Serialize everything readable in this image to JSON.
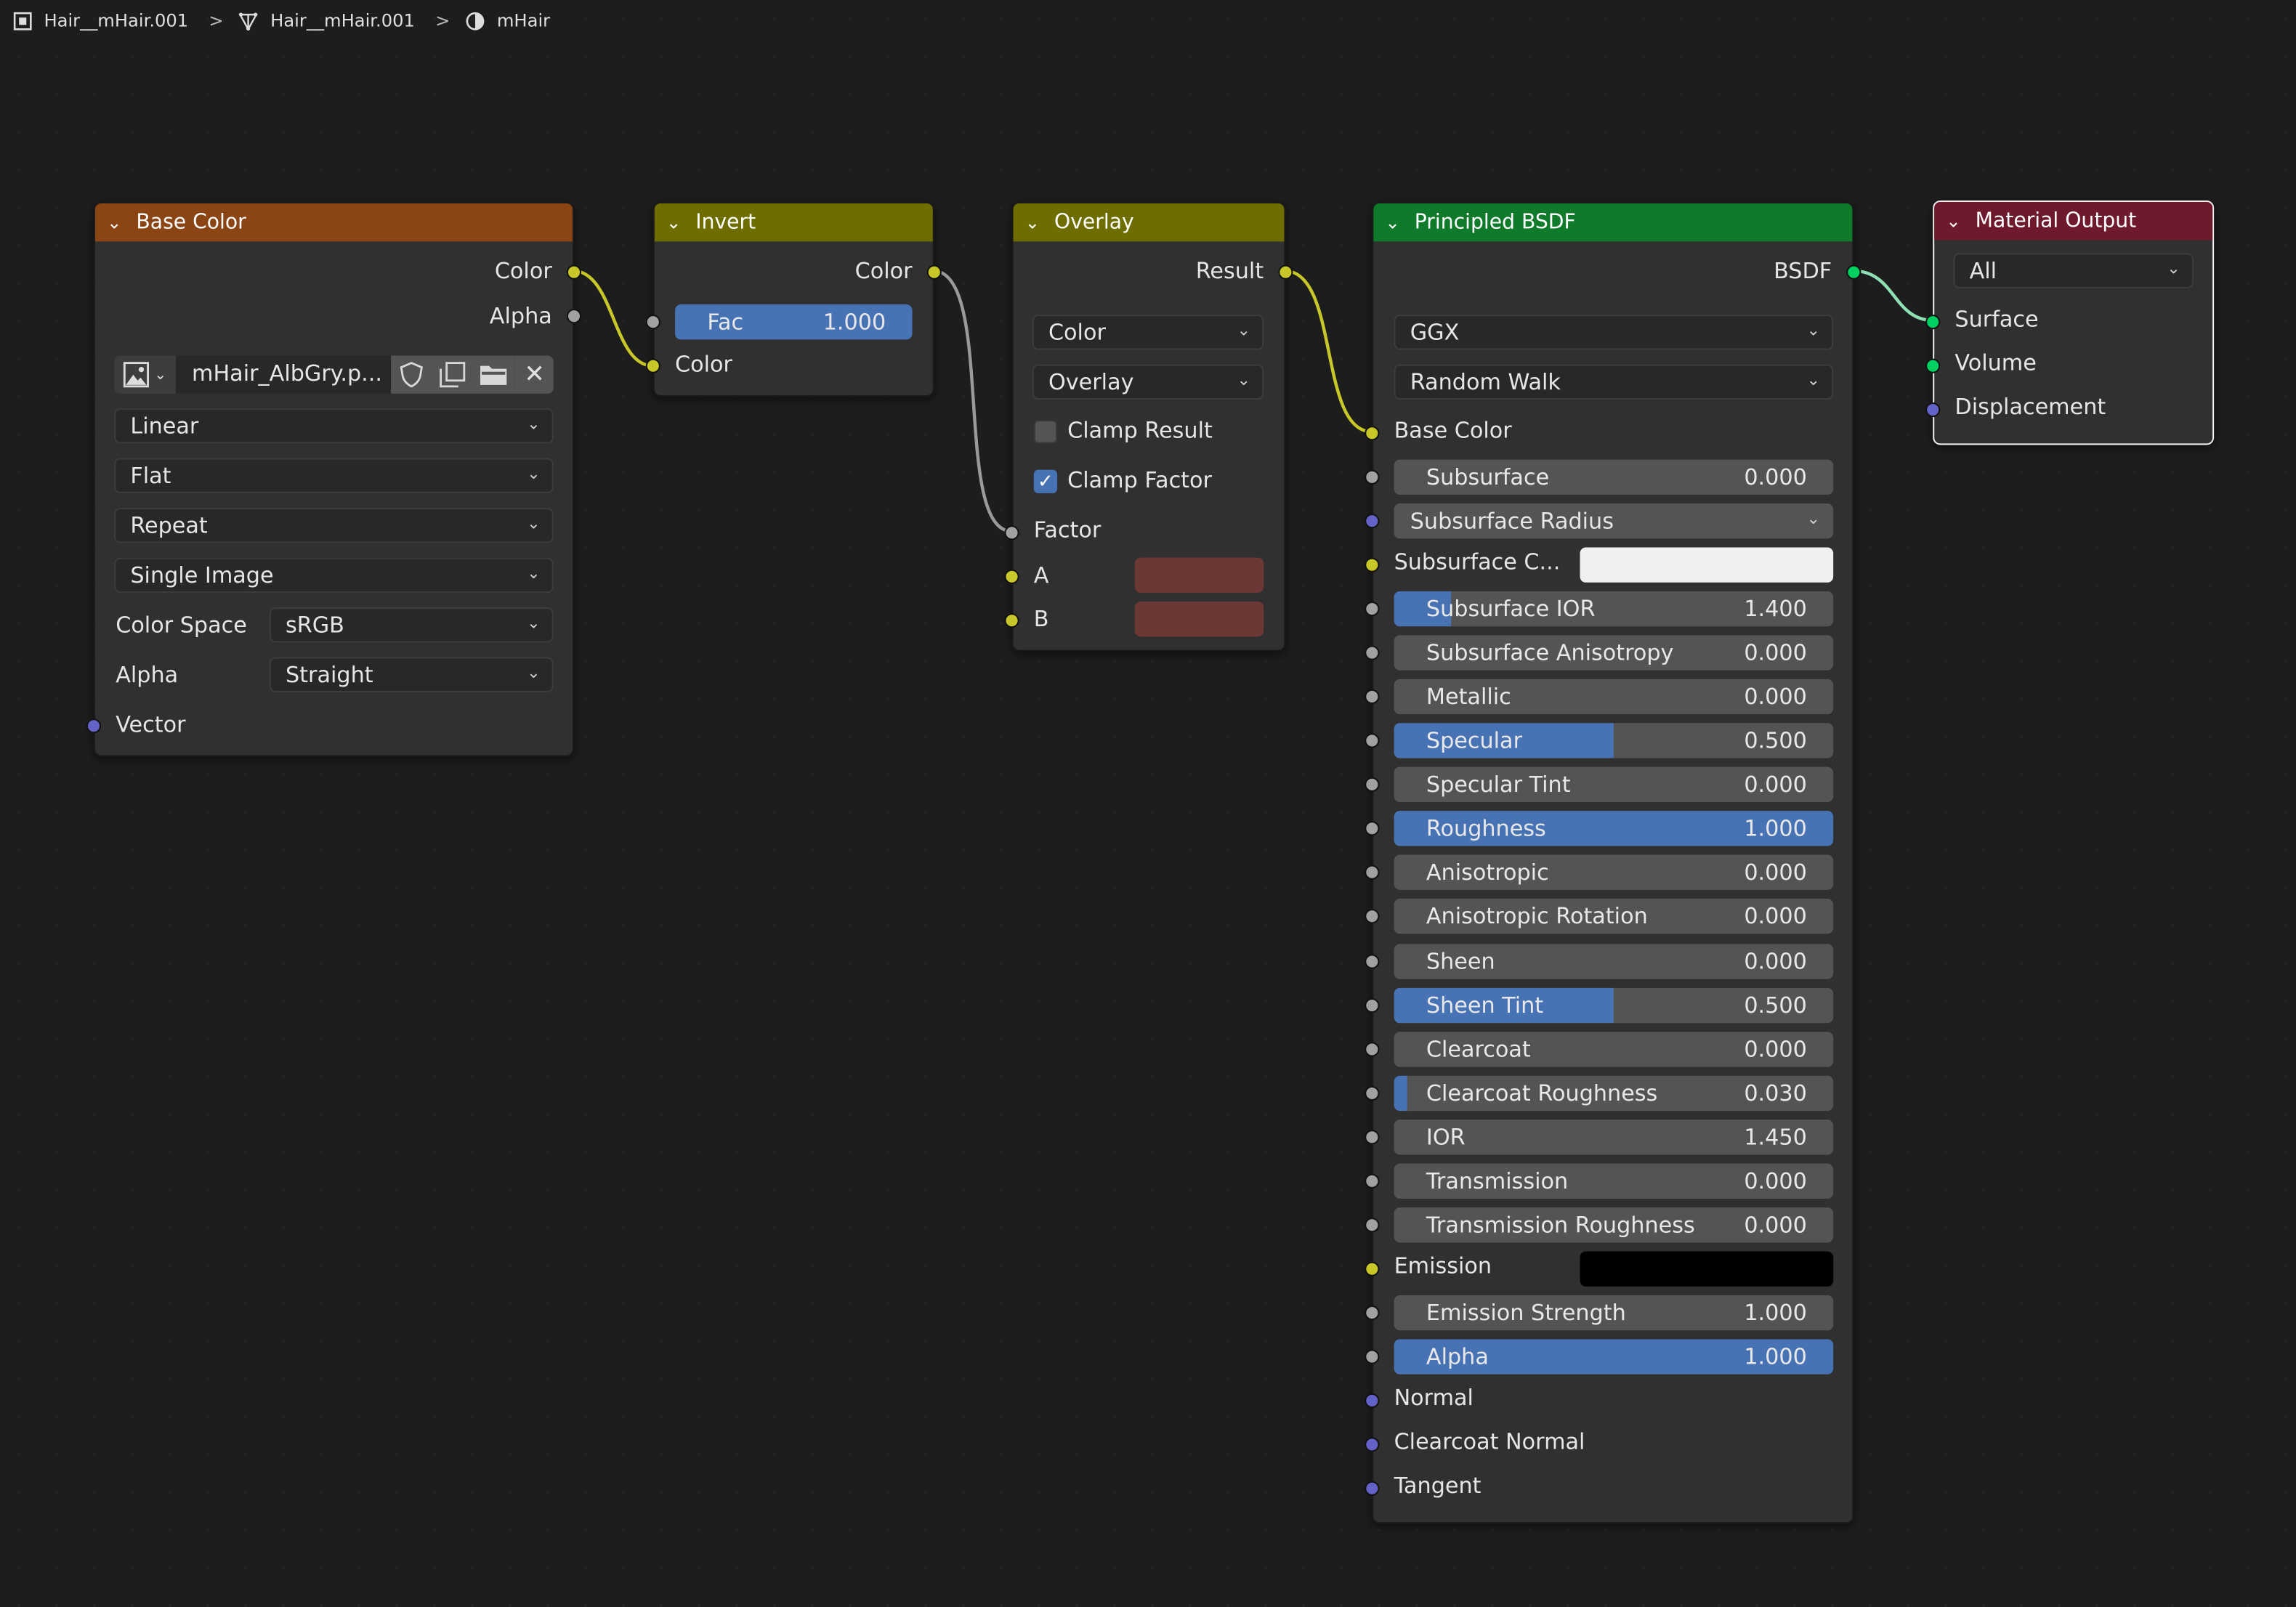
{
  "breadcrumb": [
    {
      "label": "Hair__mHair.001",
      "icon": "object-icon"
    },
    {
      "label": "Hair__mHair.001",
      "icon": "mesh-icon"
    },
    {
      "label": "mHair",
      "icon": "material-icon"
    }
  ],
  "colors": {
    "header_texture": "#8b4514",
    "header_converter": "#6e6e00",
    "header_color_mix": "#6e6e00",
    "header_shader": "#0e7a2a",
    "header_output": "#6e1a2c",
    "slider_fill": "#4772b3",
    "wire_color": "#c7c729",
    "wire_gray": "#8a8a8a",
    "wire_shader": "#7ee0a8"
  },
  "base_color_node": {
    "title": "Base Color",
    "outputs": [
      "Color",
      "Alpha"
    ],
    "image_name": "mHair_AlbGry.p...",
    "interpolation": "Linear",
    "projection": "Flat",
    "extension": "Repeat",
    "source": "Single Image",
    "color_space_label": "Color Space",
    "color_space": "sRGB",
    "alpha_label": "Alpha",
    "alpha_mode": "Straight",
    "vector_label": "Vector"
  },
  "invert_node": {
    "title": "Invert",
    "output": "Color",
    "fac_label": "Fac",
    "fac_value": "1.000",
    "input_color": "Color"
  },
  "overlay_node": {
    "title": "Overlay",
    "output": "Result",
    "data_type": "Color",
    "blend_mode": "Overlay",
    "clamp_result": "Clamp Result",
    "clamp_factor": "Clamp Factor",
    "clamp_result_checked": false,
    "clamp_factor_checked": true,
    "factor_label": "Factor",
    "a_label": "A",
    "b_label": "B",
    "swatch_color": "#6b3835"
  },
  "bsdf_node": {
    "title": "Principled BSDF",
    "output": "BSDF",
    "distribution": "GGX",
    "subsurface_method": "Random Walk",
    "base_color_label": "Base Color",
    "subsurface_radius": "Subsurface Radius",
    "subsurface_color_label": "Subsurface C...",
    "sliders": [
      {
        "label": "Subsurface",
        "value": "0.000",
        "fill": 0.0
      },
      {
        "label": "Subsurface IOR",
        "value": "1.400",
        "fill": 0.13
      },
      {
        "label": "Subsurface Anisotropy",
        "value": "0.000",
        "fill": 0.0
      },
      {
        "label": "Metallic",
        "value": "0.000",
        "fill": 0.0
      },
      {
        "label": "Specular",
        "value": "0.500",
        "fill": 0.5
      },
      {
        "label": "Specular Tint",
        "value": "0.000",
        "fill": 0.0
      },
      {
        "label": "Roughness",
        "value": "1.000",
        "fill": 1.0
      },
      {
        "label": "Anisotropic",
        "value": "0.000",
        "fill": 0.0
      },
      {
        "label": "Anisotropic Rotation",
        "value": "0.000",
        "fill": 0.0
      },
      {
        "label": "Sheen",
        "value": "0.000",
        "fill": 0.0
      },
      {
        "label": "Sheen Tint",
        "value": "0.500",
        "fill": 0.5
      },
      {
        "label": "Clearcoat",
        "value": "0.000",
        "fill": 0.0
      },
      {
        "label": "Clearcoat Roughness",
        "value": "0.030",
        "fill": 0.03
      },
      {
        "label": "IOR",
        "value": "1.450",
        "fill": 0.0
      },
      {
        "label": "Transmission",
        "value": "0.000",
        "fill": 0.0
      },
      {
        "label": "Transmission Roughness",
        "value": "0.000",
        "fill": 0.0
      }
    ],
    "emission_label": "Emission",
    "emission_strength": {
      "label": "Emission Strength",
      "value": "1.000",
      "fill": 0.0
    },
    "alpha": {
      "label": "Alpha",
      "value": "1.000",
      "fill": 1.0
    },
    "normal_label": "Normal",
    "clearcoat_normal_label": "Clearcoat Normal",
    "tangent_label": "Tangent"
  },
  "output_node": {
    "title": "Material Output",
    "target": "All",
    "inputs": [
      "Surface",
      "Volume",
      "Displacement"
    ]
  }
}
